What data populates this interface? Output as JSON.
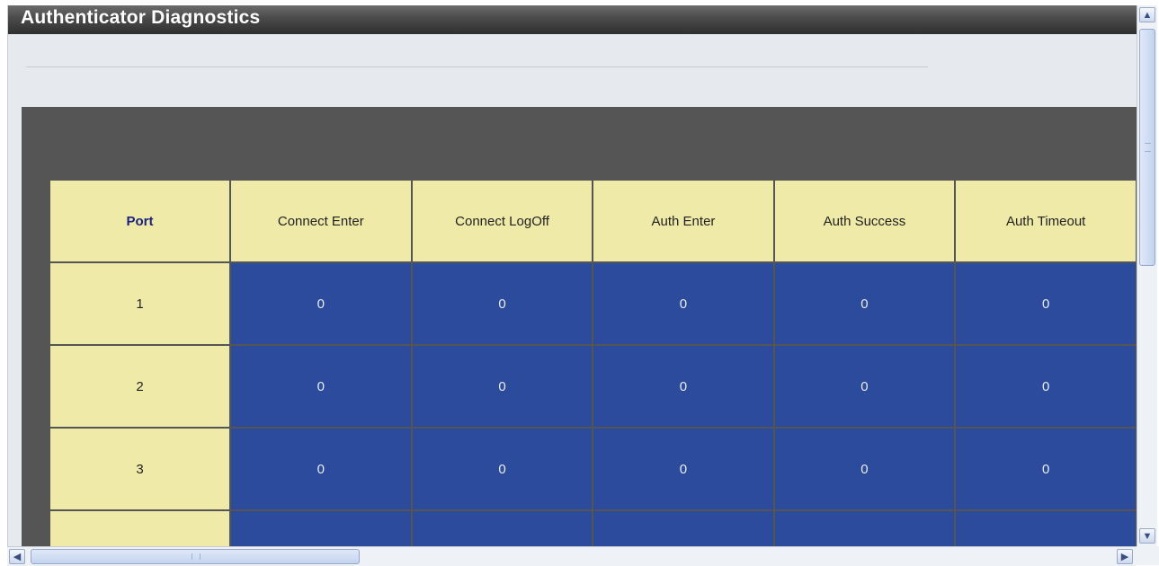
{
  "window": {
    "title": "Authenticator Diagnostics"
  },
  "table": {
    "headers": [
      "Port",
      "Connect Enter",
      "Connect LogOff",
      "Auth Enter",
      "Auth Success",
      "Auth Timeout"
    ],
    "rows": [
      {
        "port": "1",
        "values": [
          "0",
          "0",
          "0",
          "0",
          "0"
        ]
      },
      {
        "port": "2",
        "values": [
          "0",
          "0",
          "0",
          "0",
          "0"
        ]
      },
      {
        "port": "3",
        "values": [
          "0",
          "0",
          "0",
          "0",
          "0"
        ]
      },
      {
        "port": "",
        "values": [
          "",
          "",
          "",
          "",
          ""
        ]
      }
    ]
  },
  "scrollbars": {
    "up_icon": "chevron-up-icon",
    "down_icon": "chevron-down-icon",
    "left_icon": "chevron-left-icon",
    "right_icon": "chevron-right-icon"
  },
  "colors": {
    "header_bg": "#f0eaa8",
    "value_bg": "#2c4b9c",
    "panel_bg": "#555555",
    "port_header_text": "#1a237e"
  }
}
